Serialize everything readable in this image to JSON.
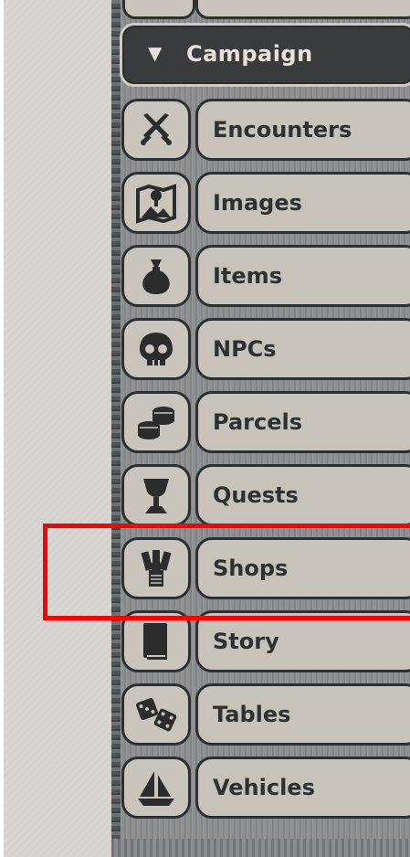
{
  "campaign": {
    "arrow": "▼",
    "label": "Campaign"
  },
  "items": [
    {
      "label": "Encounters",
      "icon": "crossed-swords-icon"
    },
    {
      "label": "Images",
      "icon": "map-pin-icon"
    },
    {
      "label": "Items",
      "icon": "sack-icon"
    },
    {
      "label": "NPCs",
      "icon": "skull-icon"
    },
    {
      "label": "Parcels",
      "icon": "coins-icon"
    },
    {
      "label": "Quests",
      "icon": "goblet-icon"
    },
    {
      "label": "Shops",
      "icon": "shopkeeper-icon"
    },
    {
      "label": "Story",
      "icon": "book-icon"
    },
    {
      "label": "Tables",
      "icon": "dice-icon"
    },
    {
      "label": "Vehicles",
      "icon": "ship-icon"
    }
  ],
  "highlight_target": "Shops"
}
